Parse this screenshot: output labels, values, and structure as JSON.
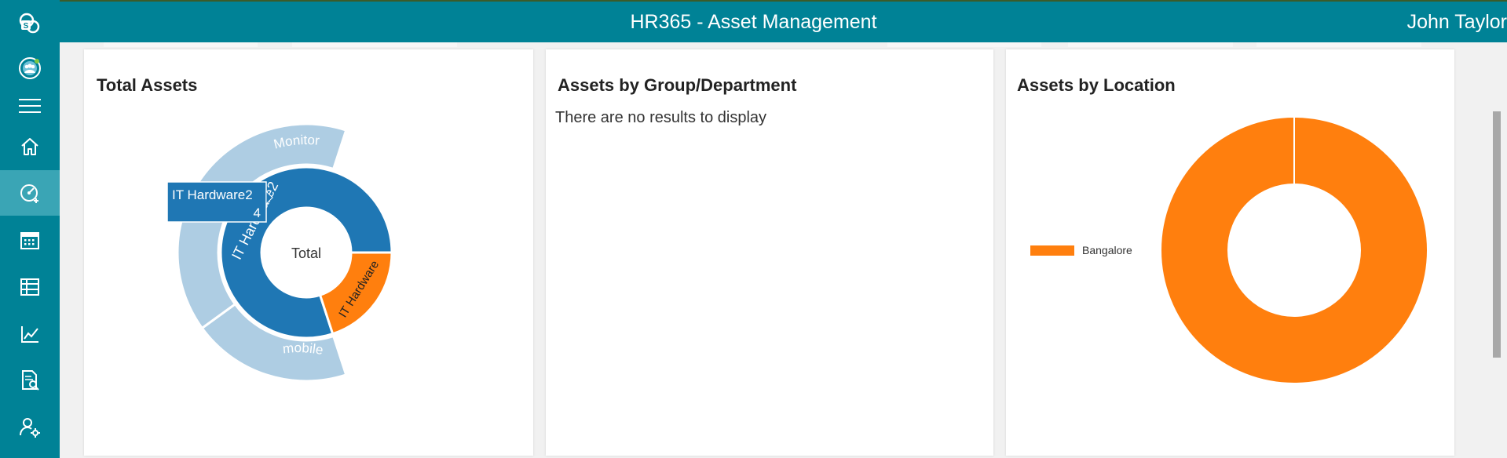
{
  "header": {
    "title": "HR365 - Asset Management",
    "user": "John Taylor"
  },
  "sidebar": {
    "items": [
      {
        "icon": "sharepoint-logo-icon"
      },
      {
        "icon": "people-app-icon"
      },
      {
        "icon": "menu-icon"
      },
      {
        "icon": "home-icon"
      },
      {
        "icon": "dashboard-icon",
        "active": true
      },
      {
        "icon": "calendar-icon"
      },
      {
        "icon": "table-icon"
      },
      {
        "icon": "chart-line-icon"
      },
      {
        "icon": "report-search-icon"
      },
      {
        "icon": "user-settings-icon"
      }
    ]
  },
  "cards": {
    "total_assets": {
      "title": "Total Assets",
      "center_label": "Total",
      "tooltip": {
        "label": "IT Hardware2",
        "value": "4"
      },
      "ring_labels": {
        "inner_a": "IT Hardware2",
        "inner_b": "IT Hardware",
        "outer_a": "Monitor",
        "outer_b": "mobile"
      }
    },
    "by_group": {
      "title": "Assets by Group/Department",
      "empty_message": "There are no results to display"
    },
    "by_location": {
      "title": "Assets by Location",
      "legend": "Bangalore"
    }
  },
  "chart_data": [
    {
      "type": "sunburst",
      "title": "Total Assets",
      "root": "Total",
      "children": [
        {
          "name": "IT Hardware2",
          "value": 4,
          "children": [
            {
              "name": "Monitor",
              "value": 2
            },
            {
              "name": "mobile",
              "value": 1
            }
          ]
        },
        {
          "name": "IT Hardware",
          "value": 1
        }
      ]
    },
    {
      "type": "pie",
      "title": "Assets by Location",
      "categories": [
        "Bangalore"
      ],
      "values": [
        1
      ],
      "legend": "left"
    }
  ],
  "colors": {
    "header": "#008296",
    "accent_blue": "#1f77b4",
    "light_blue": "#aecde3",
    "orange": "#ff7f0e"
  }
}
